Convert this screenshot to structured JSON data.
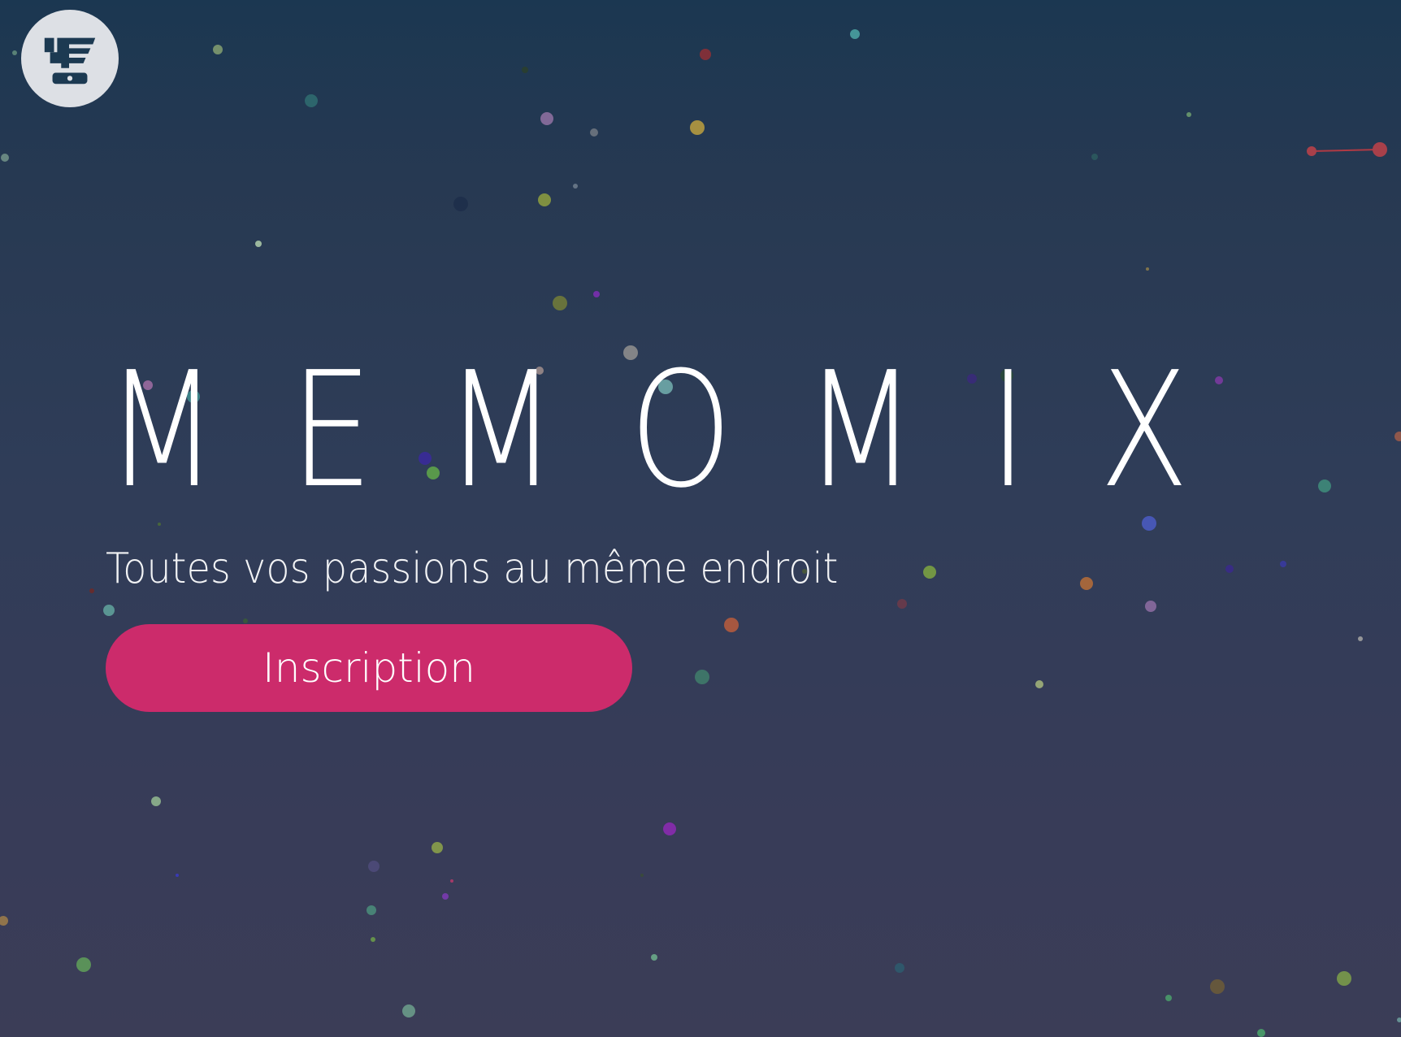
{
  "header": {
    "logo_icon": "memomix-logo-icon"
  },
  "hero": {
    "title": "MEMOMIX",
    "tagline": "Toutes vos passions au même endroit",
    "cta_label": "Inscription"
  },
  "colors": {
    "background_top": "#1b3751",
    "background_bottom": "#3b3d57",
    "accent": "#cc2b6b",
    "logo_circle": "#dde0e5",
    "logo_glyph": "#1c3a52",
    "text": "#ffffff"
  }
}
